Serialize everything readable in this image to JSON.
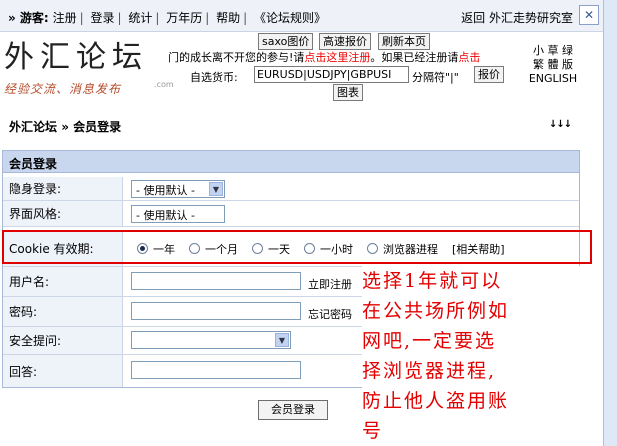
{
  "topbar": {
    "guest_label": "» 游客:",
    "links": [
      "注册",
      "登录",
      "统计",
      "万年历",
      "帮助",
      "《论坛规则》"
    ],
    "return_text": "返回 外汇走势研究室",
    "close_glyph": "✕"
  },
  "logo": {
    "name": "外汇论坛",
    "slogan": "经验交流、消息发布",
    "domain": ".com"
  },
  "header_buttons": {
    "saxo": "saxo图价",
    "quote": "高速报价",
    "refresh": "刷新本页",
    "quote2": "报价",
    "chart": "图表"
  },
  "promo": {
    "prefix": "门的成长离不开您的参与!请",
    "red1": "点击这里注册",
    "middle": "。如果已经注册请",
    "red2": "点击"
  },
  "currency": {
    "label": "自选货币:",
    "value": "EURUSD|USDJPY|GBPUSI",
    "separator_note": "分隔符\"|\""
  },
  "font_options": {
    "line1": "小 草 绿",
    "line2": "繁 體 版",
    "line3": "ENGLISH"
  },
  "breadcrumb": {
    "forum": "外汇论坛",
    "sep": "»",
    "page": "会员登录",
    "arrows": "↓↓↓"
  },
  "form": {
    "title": "会员登录",
    "hidden_login": {
      "label": "隐身登录:",
      "value": "- 使用默认 -"
    },
    "style": {
      "label": "界面风格:",
      "value": "- 使用默认 -"
    },
    "cookie": {
      "label": "Cookie 有效期:",
      "options": [
        "一年",
        "一个月",
        "一天",
        "一小时",
        "浏览器进程"
      ],
      "selected": 0,
      "help": "[相关帮助]"
    },
    "username": {
      "label": "用户名:",
      "link": "立即注册"
    },
    "password": {
      "label": "密码:",
      "link": "忘记密码"
    },
    "security": {
      "label": "安全提问:"
    },
    "answer": {
      "label": "回答:"
    },
    "submit": "会员登录"
  },
  "annotation": {
    "line1": "选择1年就可以",
    "line2": "在公共场所例如",
    "line3": "网吧,一定要选",
    "line4": "择浏览器进程,",
    "line5": "防止他人盗用账",
    "line6": "号"
  },
  "colors": {
    "accent_red": "#e00000",
    "panel_header": "#c9d7ee",
    "label_bg": "#eef2f9"
  }
}
